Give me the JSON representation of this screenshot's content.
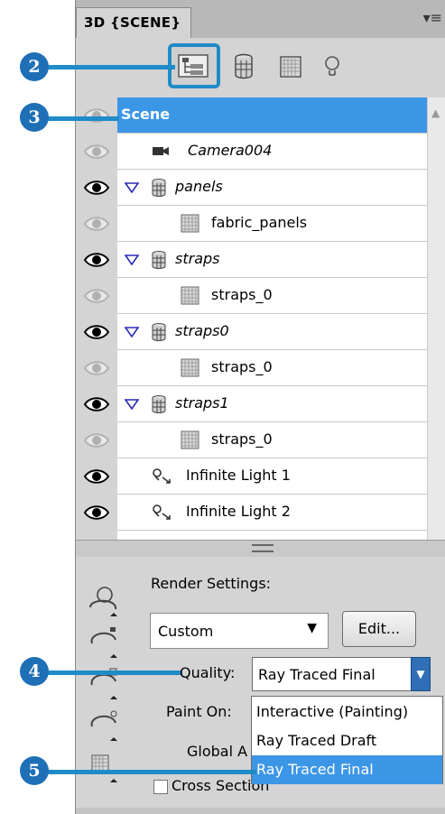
{
  "panel": {
    "tab_title": "3D {SCENE}",
    "menu_icon": "panel-menu-icon"
  },
  "toolbar": {
    "buttons": [
      {
        "name": "scene-filter-button",
        "icon": "scene-tree-icon",
        "active": true
      },
      {
        "name": "meshes-filter-button",
        "icon": "mesh-cylinder-icon"
      },
      {
        "name": "materials-filter-button",
        "icon": "material-grid-icon"
      },
      {
        "name": "lights-filter-button",
        "icon": "lightbulb-icon"
      }
    ]
  },
  "layers": [
    {
      "label": "Scene",
      "italic": false,
      "bold": true,
      "selected": true,
      "eye": "dim",
      "kind": "root",
      "indent": 0
    },
    {
      "label": "Camera004",
      "italic": true,
      "eye": "dim",
      "kind": "camera",
      "indent": 1
    },
    {
      "label": "panels",
      "italic": true,
      "eye": "on",
      "kind": "mesh",
      "expanded": true,
      "indent": 1
    },
    {
      "label": "fabric_panels",
      "italic": false,
      "eye": "dim",
      "kind": "material",
      "indent": 2
    },
    {
      "label": "straps",
      "italic": true,
      "eye": "on",
      "kind": "mesh",
      "expanded": true,
      "indent": 1
    },
    {
      "label": "straps_0",
      "italic": false,
      "eye": "dim",
      "kind": "material",
      "indent": 2
    },
    {
      "label": "straps0",
      "italic": true,
      "eye": "on",
      "kind": "mesh",
      "expanded": true,
      "indent": 1
    },
    {
      "label": "straps_0",
      "italic": false,
      "eye": "dim",
      "kind": "material",
      "indent": 2
    },
    {
      "label": "straps1",
      "italic": true,
      "eye": "on",
      "kind": "mesh",
      "expanded": true,
      "indent": 1
    },
    {
      "label": "straps_0",
      "italic": false,
      "eye": "dim",
      "kind": "material",
      "indent": 2
    },
    {
      "label": "Infinite Light 1",
      "italic": false,
      "eye": "on",
      "kind": "light",
      "indent": 1
    },
    {
      "label": "Infinite Light 2",
      "italic": false,
      "eye": "on",
      "kind": "light",
      "indent": 1
    }
  ],
  "render": {
    "settings_label": "Render Settings:",
    "preset_value": "Custom",
    "preset_arrow": "▼",
    "edit_label": "Edit...",
    "quality_label": "Quality:",
    "quality_value": "Ray Traced Final",
    "quality_arrow": "▼",
    "paint_on_label": "Paint On:",
    "global_label": "Global A",
    "cross_section_label": "Cross Section",
    "cross_section_checked": false
  },
  "quality_options": [
    {
      "label": "Interactive (Painting)",
      "selected": false
    },
    {
      "label": "Ray Traced Draft",
      "selected": false
    },
    {
      "label": "Ray Traced Final",
      "selected": true
    }
  ],
  "callouts": [
    "2",
    "3",
    "4",
    "5"
  ],
  "colors": {
    "accent": "#1f8bc8",
    "callout_fill": "#1f6fb7",
    "selection": "#3c96e6",
    "panel_bg": "#d4d4d4"
  }
}
